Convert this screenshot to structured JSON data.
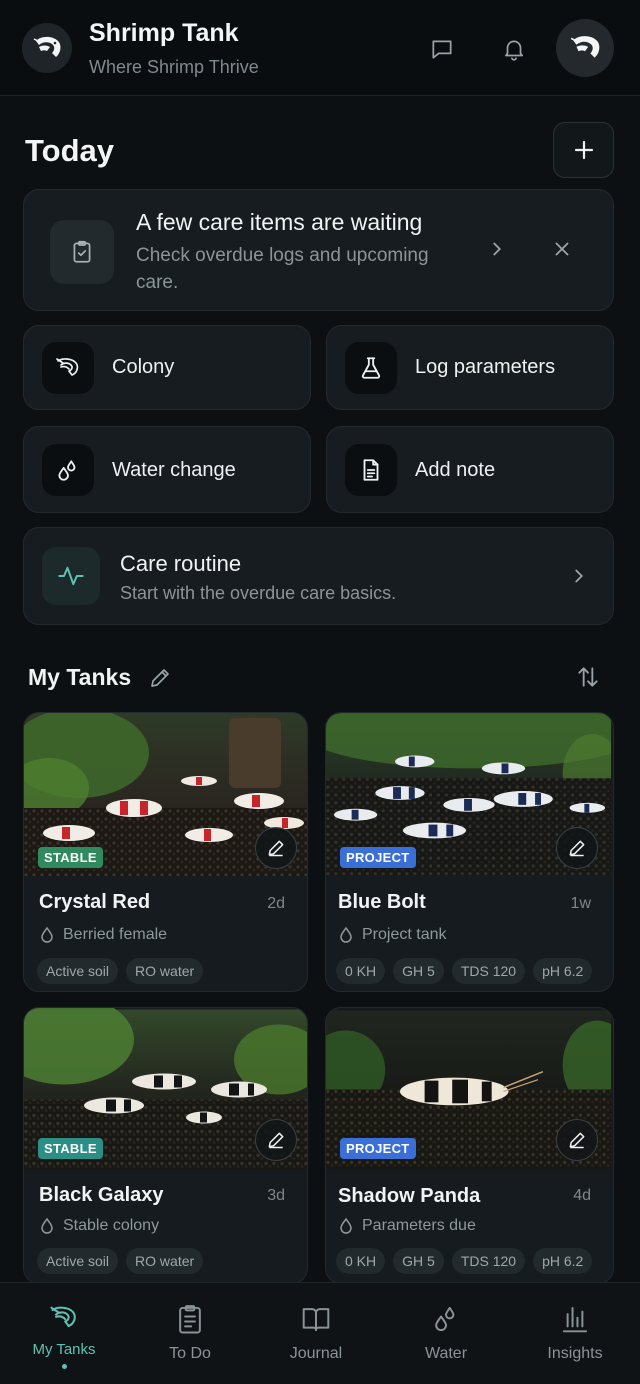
{
  "header": {
    "title": "Shrimp Tank",
    "subtitle": "Where Shrimp Thrive",
    "icons": [
      "shrimp-logo-icon",
      "chat-icon",
      "bell-icon",
      "avatar"
    ]
  },
  "today": {
    "title": "Today",
    "add_icon": "plus-icon",
    "alert": {
      "title": "A few care items are waiting",
      "body": "Check overdue logs and upcoming care."
    },
    "actions": [
      {
        "label": "Colony",
        "icon": "shrimp-icon"
      },
      {
        "label": "Log parameters",
        "icon": "flask-icon"
      },
      {
        "label": "Water change",
        "icon": "droplets-icon"
      },
      {
        "label": "Add note",
        "icon": "document-icon"
      }
    ],
    "routine": {
      "title": "Care routine",
      "subtitle": "Start with the overdue care basics."
    }
  },
  "tanks": {
    "title": "My Tanks",
    "items": [
      {
        "name": "Crystal Red",
        "age": "2d",
        "badge": "STABLE",
        "status": "Berried female",
        "tags": [
          "Active soil",
          "RO water"
        ]
      },
      {
        "name": "Blue Bolt",
        "age": "1w",
        "badge": "PROJECT",
        "status": "Project tank",
        "tags": [
          "0 KH",
          "GH 5",
          "TDS 120",
          "pH 6.2"
        ]
      },
      {
        "name": "Black Galaxy",
        "age": "3d",
        "badge": "STABLE",
        "status": "Stable colony",
        "tags": [
          "Active soil",
          "RO water"
        ]
      },
      {
        "name": "Shadow Panda",
        "age": "4d",
        "badge": "PROJECT",
        "status": "Parameters due",
        "tags": [
          "0 KH",
          "GH 5",
          "TDS 120",
          "pH 6.2"
        ]
      }
    ]
  },
  "nav": {
    "items": [
      {
        "label": "My Tanks",
        "icon": "shrimp-icon",
        "active": true
      },
      {
        "label": "To Do",
        "icon": "clipboard-icon"
      },
      {
        "label": "Journal",
        "icon": "book-icon"
      },
      {
        "label": "Water",
        "icon": "droplets-icon"
      },
      {
        "label": "Insights",
        "icon": "bar-chart-icon"
      }
    ]
  },
  "colors": {
    "background": "#0d1012",
    "card": "#161c1f",
    "accent": "#5fc0b3",
    "stable_badge": "#2f8a5e",
    "project_badge": "#3b6fd8"
  }
}
